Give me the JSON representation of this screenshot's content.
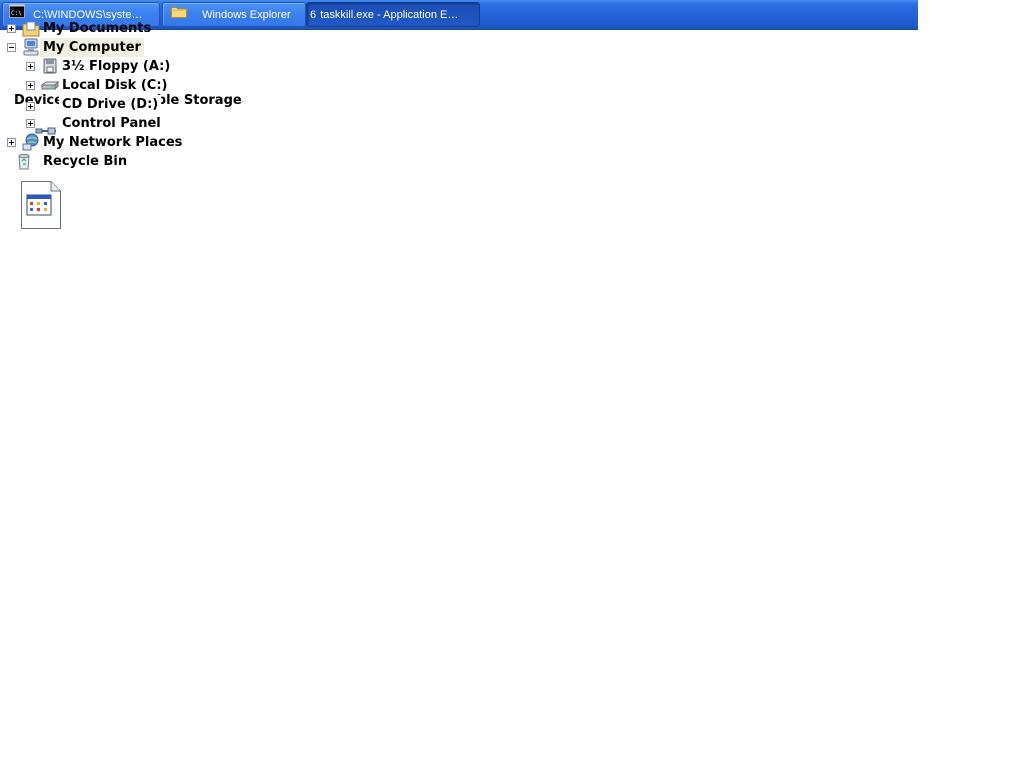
{
  "taskbar": {
    "buttons": [
      {
        "label": "C:\\WINDOWS\\syste…",
        "icon": "console-icon",
        "state": "idle"
      },
      {
        "label": "Windows Explorer",
        "icon": "folder-icon",
        "state": "idle"
      },
      {
        "count": "6",
        "label": "taskkill.exe - Application E…",
        "state": "active"
      }
    ]
  },
  "tree": {
    "items": [
      {
        "label": "My Documents",
        "expander": "plus",
        "icon": "my-documents-icon"
      },
      {
        "label": "My Computer",
        "expander": "minus",
        "icon": "my-computer-icon",
        "selected": true
      },
      {
        "label": "3½ Floppy (A:)",
        "expander": "plus",
        "icon": "floppy-drive-icon"
      },
      {
        "label": "Local Disk (C:)",
        "expander": "plus",
        "icon": "local-disk-icon"
      },
      {
        "label": "CD Drive (D:)",
        "expander": "plus",
        "icon": "cd-drive-icon"
      },
      {
        "label": "Control Panel",
        "expander": "plus",
        "icon": "control-panel-icon"
      },
      {
        "label": "My Network Places",
        "expander": "plus",
        "icon": "network-places-icon"
      },
      {
        "label": "Recycle Bin",
        "expander": "none",
        "icon": "recycle-bin-icon"
      }
    ],
    "overlay_fragments": {
      "device": "Device",
      "storage": "able Storage"
    }
  },
  "desktop_file": {
    "icon": "application-file-icon"
  },
  "colors": {
    "taskbar_blue": "#2463d8",
    "selection_bg": "#f1efe2"
  }
}
